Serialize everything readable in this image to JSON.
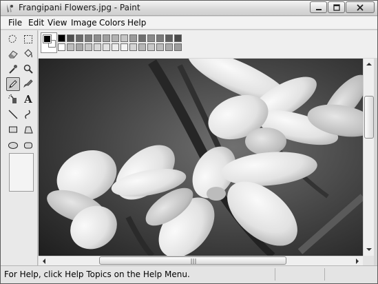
{
  "window": {
    "title": "Frangipani Flowers.jpg - Paint",
    "controls": [
      "minimize",
      "maximize",
      "close"
    ]
  },
  "menu": {
    "items": [
      "File",
      "Edit",
      "View",
      "Image",
      "Colors",
      "Help"
    ]
  },
  "toolbox": {
    "tools": [
      {
        "name": "free-form-select-icon"
      },
      {
        "name": "select-icon"
      },
      {
        "name": "eraser-icon"
      },
      {
        "name": "fill-bucket-icon"
      },
      {
        "name": "pick-color-icon"
      },
      {
        "name": "magnifier-icon"
      },
      {
        "name": "pencil-icon",
        "selected": true
      },
      {
        "name": "brush-icon"
      },
      {
        "name": "airbrush-icon"
      },
      {
        "name": "text-icon"
      },
      {
        "name": "line-icon"
      },
      {
        "name": "curve-icon"
      },
      {
        "name": "rectangle-icon"
      },
      {
        "name": "polygon-icon"
      },
      {
        "name": "ellipse-icon"
      },
      {
        "name": "rounded-rectangle-icon"
      }
    ],
    "text_tool_glyph": "A"
  },
  "palette": {
    "foreground": "#000000",
    "background": "#ffffff",
    "top_row": [
      "#000000",
      "#505050",
      "#6a6a6a",
      "#7c7c7c",
      "#8e8e8e",
      "#a0a0a0",
      "#b2b2b2",
      "#c4c4c4",
      "#9a9a9a",
      "#6e6e6e",
      "#8a8a8a",
      "#7a7a7a",
      "#5e5e5e",
      "#4a4a4a"
    ],
    "bottom_row": [
      "#ffffff",
      "#bdbdbd",
      "#a8a8a8",
      "#c6c6c6",
      "#d8d8d8",
      "#e2e2e2",
      "#ececec",
      "#f4f4f4",
      "#d4d4d4",
      "#b6b6b6",
      "#c8c8c8",
      "#bcbcbc",
      "#aaaaaa",
      "#9c9c9c"
    ]
  },
  "canvas": {
    "image": "Frangipani Flowers.jpg"
  },
  "status": {
    "text": "For Help, click Help Topics on the Help Menu."
  }
}
